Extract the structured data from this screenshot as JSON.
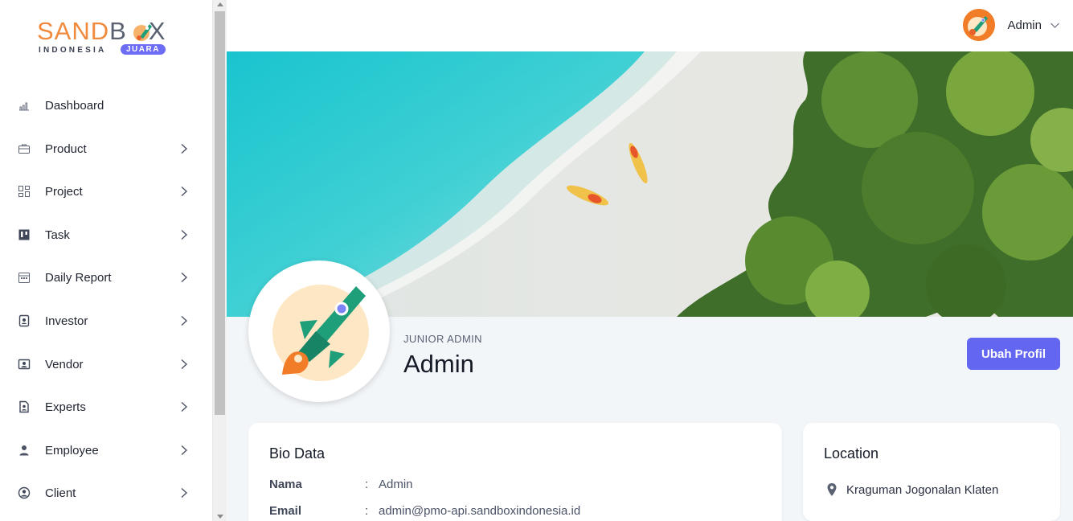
{
  "brand": {
    "logo_main_first": "SAND",
    "logo_main_rest": "B",
    "logo_main_end": "X",
    "logo_sub": "INDONESIA",
    "logo_badge": "JUARA"
  },
  "sidebar": {
    "items": [
      {
        "label": "Dashboard",
        "icon": "bar-chart-icon",
        "has_submenu": false
      },
      {
        "label": "Product",
        "icon": "briefcase-icon",
        "has_submenu": true
      },
      {
        "label": "Project",
        "icon": "grid-icon",
        "has_submenu": true
      },
      {
        "label": "Task",
        "icon": "kanban-icon",
        "has_submenu": true
      },
      {
        "label": "Daily Report",
        "icon": "calendar-icon",
        "has_submenu": true
      },
      {
        "label": "Investor",
        "icon": "contact-card-icon",
        "has_submenu": true
      },
      {
        "label": "Vendor",
        "icon": "id-card-icon",
        "has_submenu": true
      },
      {
        "label": "Experts",
        "icon": "badge-icon",
        "has_submenu": true
      },
      {
        "label": "Employee",
        "icon": "person-icon",
        "has_submenu": true
      },
      {
        "label": "Client",
        "icon": "user-circle-icon",
        "has_submenu": true
      }
    ]
  },
  "topbar": {
    "user_name": "Admin"
  },
  "profile": {
    "role": "JUNIOR ADMIN",
    "name": "Admin",
    "edit_button": "Ubah Profil"
  },
  "bio": {
    "title": "Bio Data",
    "rows": [
      {
        "key": "Nama",
        "sep": ":",
        "value": "Admin"
      },
      {
        "key": "Email",
        "sep": ":",
        "value": "admin@pmo-api.sandboxindonesia.id"
      }
    ]
  },
  "location": {
    "title": "Location",
    "address": "Kraguman Jogonalan Klaten"
  },
  "colors": {
    "accent": "#6366f1",
    "brand_orange": "#f08a3c",
    "rocket_green": "#1f9e7a"
  }
}
